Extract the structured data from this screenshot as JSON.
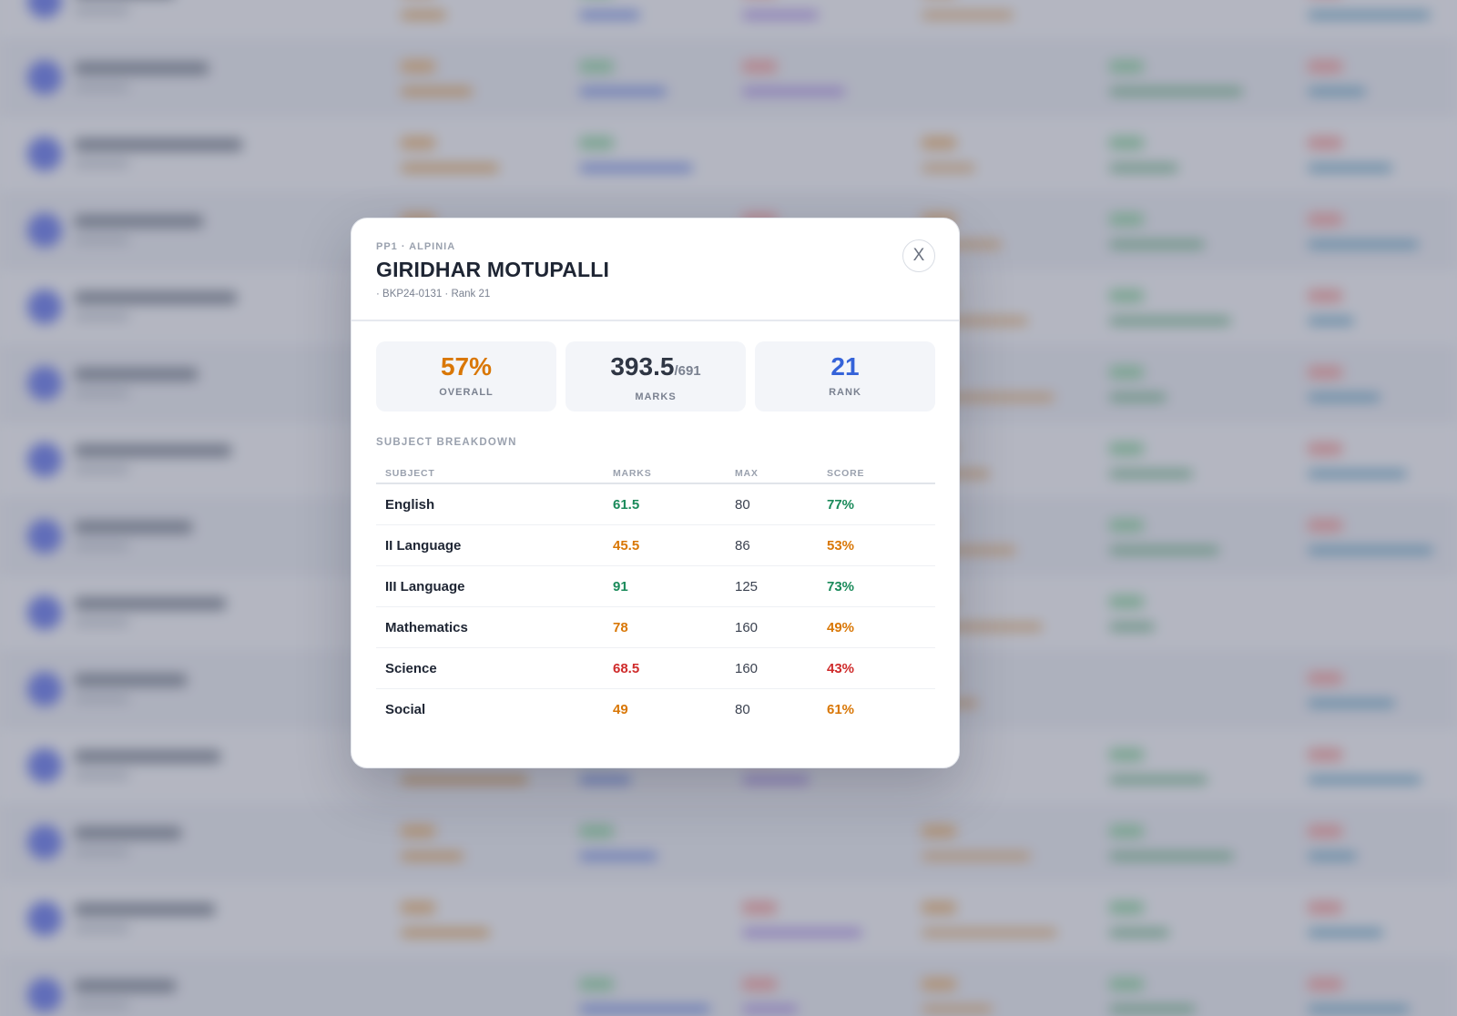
{
  "colors": {
    "good": "#1a8a5a",
    "mid": "#d97706",
    "low": "#cf2b2b",
    "rank": "#3563d9",
    "neutral": "#2f3644"
  },
  "modal": {
    "eyebrow": "PP1 · ALPINIA",
    "student_name": "GIRIDHAR MOTUPALLI",
    "meta": "· BKP24-0131 · Rank 21",
    "close_label": "X",
    "stats": {
      "overall": {
        "value": "57%",
        "label": "OVERALL",
        "tone": "mid"
      },
      "marks": {
        "value": "393.5",
        "sub": "/691",
        "label": "MARKS",
        "tone": "neutral"
      },
      "rank": {
        "value": "21",
        "label": "RANK",
        "tone": "rank"
      }
    },
    "section_title": "SUBJECT BREAKDOWN",
    "columns": [
      "SUBJECT",
      "MARKS",
      "MAX",
      "SCORE"
    ],
    "rows": [
      {
        "subject": "English",
        "marks": "61.5",
        "max": "80",
        "score": "77%",
        "tone": "good"
      },
      {
        "subject": "II Language",
        "marks": "45.5",
        "max": "86",
        "score": "53%",
        "tone": "mid"
      },
      {
        "subject": "III Language",
        "marks": "91",
        "max": "125",
        "score": "73%",
        "tone": "good"
      },
      {
        "subject": "Mathematics",
        "marks": "78",
        "max": "160",
        "score": "49%",
        "tone": "mid"
      },
      {
        "subject": "Science",
        "marks": "68.5",
        "max": "160",
        "score": "43%",
        "tone": "low"
      },
      {
        "subject": "Social",
        "marks": "49",
        "max": "80",
        "score": "61%",
        "tone": "mid"
      }
    ]
  }
}
